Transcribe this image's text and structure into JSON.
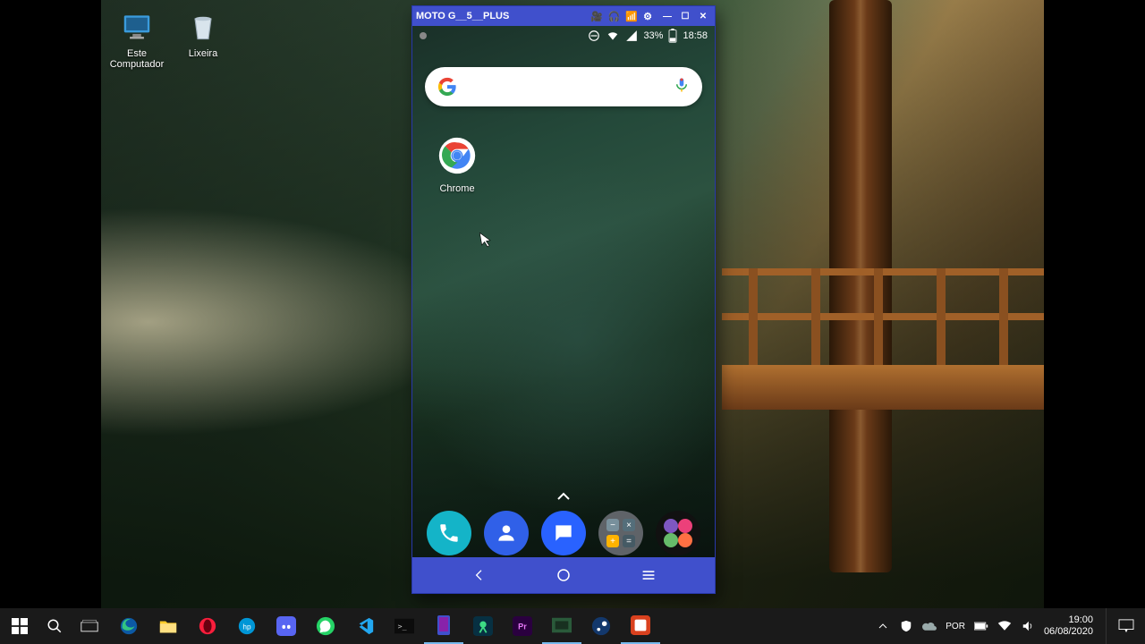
{
  "desktop": {
    "icons": {
      "computer": "Este Computador",
      "recycle": "Lixeira"
    }
  },
  "scrcpy": {
    "title": "MOTO G__5__PLUS",
    "status": {
      "battery": "33%",
      "time": "18:58"
    },
    "apps": {
      "chrome": "Chrome"
    }
  },
  "taskbar": {
    "clock_time": "19:00",
    "clock_date": "06/08/2020"
  }
}
